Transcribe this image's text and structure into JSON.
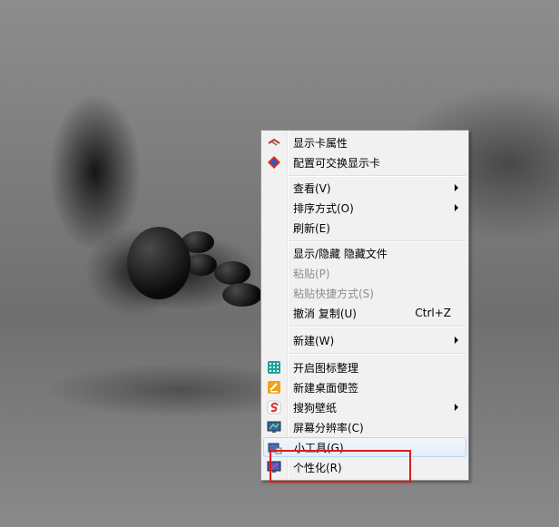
{
  "menu": {
    "items": [
      {
        "label": "显示卡属性",
        "shortcut": "",
        "submenu": false,
        "disabled": false,
        "icon": "display-card-properties-icon"
      },
      {
        "label": "配置可交换显示卡",
        "shortcut": "",
        "submenu": false,
        "disabled": false,
        "icon": "switchable-graphics-icon"
      },
      {
        "label": "查看(V)",
        "shortcut": "",
        "submenu": true,
        "disabled": false,
        "icon": ""
      },
      {
        "label": "排序方式(O)",
        "shortcut": "",
        "submenu": true,
        "disabled": false,
        "icon": ""
      },
      {
        "label": "刷新(E)",
        "shortcut": "",
        "submenu": false,
        "disabled": false,
        "icon": ""
      },
      {
        "label": "显示/隐藏 隐藏文件",
        "shortcut": "",
        "submenu": false,
        "disabled": false,
        "icon": ""
      },
      {
        "label": "粘贴(P)",
        "shortcut": "",
        "submenu": false,
        "disabled": true,
        "icon": ""
      },
      {
        "label": "粘贴快捷方式(S)",
        "shortcut": "",
        "submenu": false,
        "disabled": true,
        "icon": ""
      },
      {
        "label": "撤消 复制(U)",
        "shortcut": "Ctrl+Z",
        "submenu": false,
        "disabled": false,
        "icon": ""
      },
      {
        "label": "新建(W)",
        "shortcut": "",
        "submenu": true,
        "disabled": false,
        "icon": ""
      },
      {
        "label": "开启图标整理",
        "shortcut": "",
        "submenu": false,
        "disabled": false,
        "icon": "icon-organize-icon"
      },
      {
        "label": "新建桌面便签",
        "shortcut": "",
        "submenu": false,
        "disabled": false,
        "icon": "sticky-note-icon"
      },
      {
        "label": "搜狗壁纸",
        "shortcut": "",
        "submenu": true,
        "disabled": false,
        "icon": "sogou-wallpaper-icon"
      },
      {
        "label": "屏幕分辨率(C)",
        "shortcut": "",
        "submenu": false,
        "disabled": false,
        "icon": "screen-resolution-icon"
      },
      {
        "label": "小工具(G)",
        "shortcut": "",
        "submenu": false,
        "disabled": false,
        "icon": "gadgets-icon"
      },
      {
        "label": "个性化(R)",
        "shortcut": "",
        "submenu": false,
        "disabled": false,
        "icon": "personalize-icon"
      }
    ]
  },
  "colors": {
    "menu_background": "#f1f1f1",
    "hover_border": "#b8d6fb",
    "annotation_red": "#e01a1a",
    "disabled_text": "#8d8d8d"
  }
}
